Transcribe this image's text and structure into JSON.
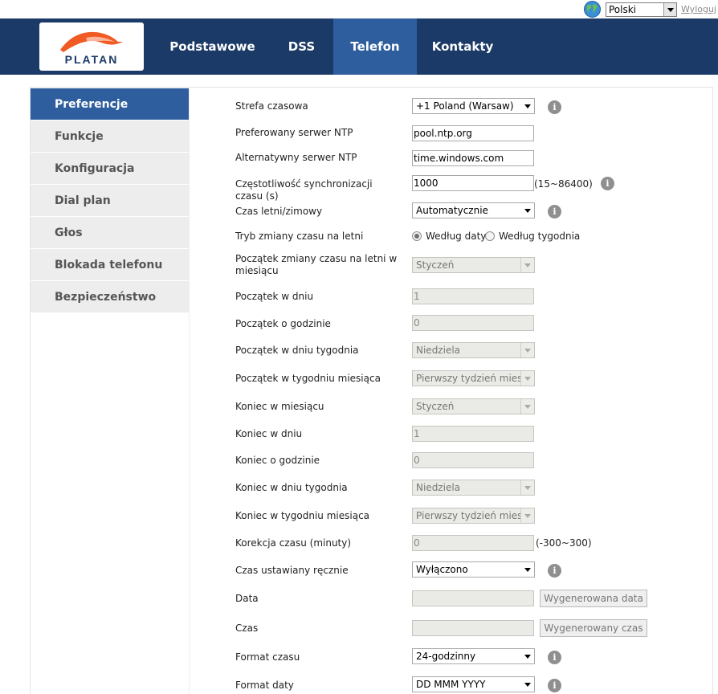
{
  "topbar": {
    "language": "Polski",
    "logout": "Wyloguj"
  },
  "header": {
    "logo_text": "PLATAN",
    "nav": [
      "Podstawowe",
      "DSS",
      "Telefon",
      "Kontakty"
    ],
    "active_nav": "Telefon"
  },
  "sidebar": {
    "items": [
      "Preferencje",
      "Funkcje",
      "Konfiguracja",
      "Dial plan",
      "Głos",
      "Blokada telefonu",
      "Bezpieczeństwo"
    ],
    "active": "Preferencje"
  },
  "form": {
    "timezone": {
      "label": "Strefa czasowa",
      "value": "+1 Poland (Warsaw)"
    },
    "ntp_primary": {
      "label": "Preferowany serwer NTP",
      "value": "pool.ntp.org"
    },
    "ntp_alt": {
      "label": "Alternatywny serwer NTP",
      "value": "time.windows.com"
    },
    "sync_freq": {
      "label": "Częstotliwość synchronizacji czasu (s)",
      "value": "1000",
      "hint": "(15~86400)"
    },
    "dst": {
      "label": "Czas letni/zimowy",
      "value": "Automatycznie"
    },
    "dst_mode": {
      "label": "Tryb zmiany czasu na letni",
      "opt1": "Według daty",
      "opt2": "Według tygodnia",
      "selected": "Według daty"
    },
    "start_month": {
      "label": "Początek zmiany czasu na letni w miesiącu",
      "value": "Styczeń"
    },
    "start_day": {
      "label": "Początek w dniu",
      "value": "1"
    },
    "start_hour": {
      "label": "Początek o godzinie",
      "value": "0"
    },
    "start_weekday": {
      "label": "Początek w dniu tygodnia",
      "value": "Niedziela"
    },
    "start_week": {
      "label": "Początek w tygodniu miesiąca",
      "value": "Pierwszy tydzień miesi"
    },
    "end_month": {
      "label": "Koniec w miesiącu",
      "value": "Styczeń"
    },
    "end_day": {
      "label": "Koniec w dniu",
      "value": "1"
    },
    "end_hour": {
      "label": "Koniec o godzinie",
      "value": "0"
    },
    "end_weekday": {
      "label": "Koniec w dniu tygodnia",
      "value": "Niedziela"
    },
    "end_week": {
      "label": "Koniec w tygodniu miesiąca",
      "value": "Pierwszy tydzień miesi"
    },
    "offset": {
      "label": "Korekcja czasu (minuty)",
      "value": "0",
      "hint": "(-300~300)"
    },
    "manual": {
      "label": "Czas ustawiany ręcznie",
      "value": "Wyłączono"
    },
    "date": {
      "label": "Data",
      "value": "",
      "button": "Wygenerowana data"
    },
    "time": {
      "label": "Czas",
      "value": "",
      "button": "Wygenerowany czas"
    },
    "time_format": {
      "label": "Format czasu",
      "value": "24-godzinny"
    },
    "date_format": {
      "label": "Format daty",
      "value": "DD MMM YYYY"
    }
  },
  "info_glyph": "i",
  "colors": {
    "header_bg": "#1b3a67",
    "active_bg": "#2e5e9e",
    "logo_orange": "#f15a22"
  }
}
